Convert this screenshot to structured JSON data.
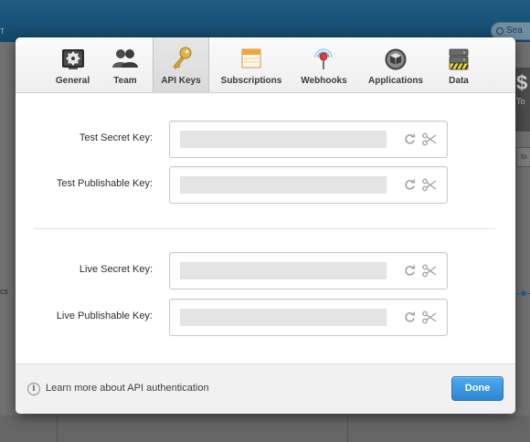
{
  "background": {
    "left_word": "cs",
    "crumb": "T",
    "search_placeholder": "Sea",
    "dollar": "$",
    "total_text": "To",
    "select_text": "to"
  },
  "tabs": [
    {
      "label": "General",
      "icon": "gear-icon"
    },
    {
      "label": "Team",
      "icon": "team-icon"
    },
    {
      "label": "API Keys",
      "icon": "key-icon",
      "active": true
    },
    {
      "label": "Subscriptions",
      "icon": "calendar-icon"
    },
    {
      "label": "Webhooks",
      "icon": "pin-icon"
    },
    {
      "label": "Applications",
      "icon": "box-icon"
    },
    {
      "label": "Data",
      "icon": "database-icon"
    }
  ],
  "keys": {
    "test_secret_label": "Test Secret Key:",
    "test_publishable_label": "Test Publishable Key:",
    "live_secret_label": "Live Secret Key:",
    "live_publishable_label": "Live Publishable Key:"
  },
  "footer": {
    "info_symbol": "i",
    "learn_more": "Learn more about API authentication",
    "done_label": "Done"
  },
  "colors": {
    "accent": "#2b87d3",
    "header_bar": "#1a5179"
  }
}
